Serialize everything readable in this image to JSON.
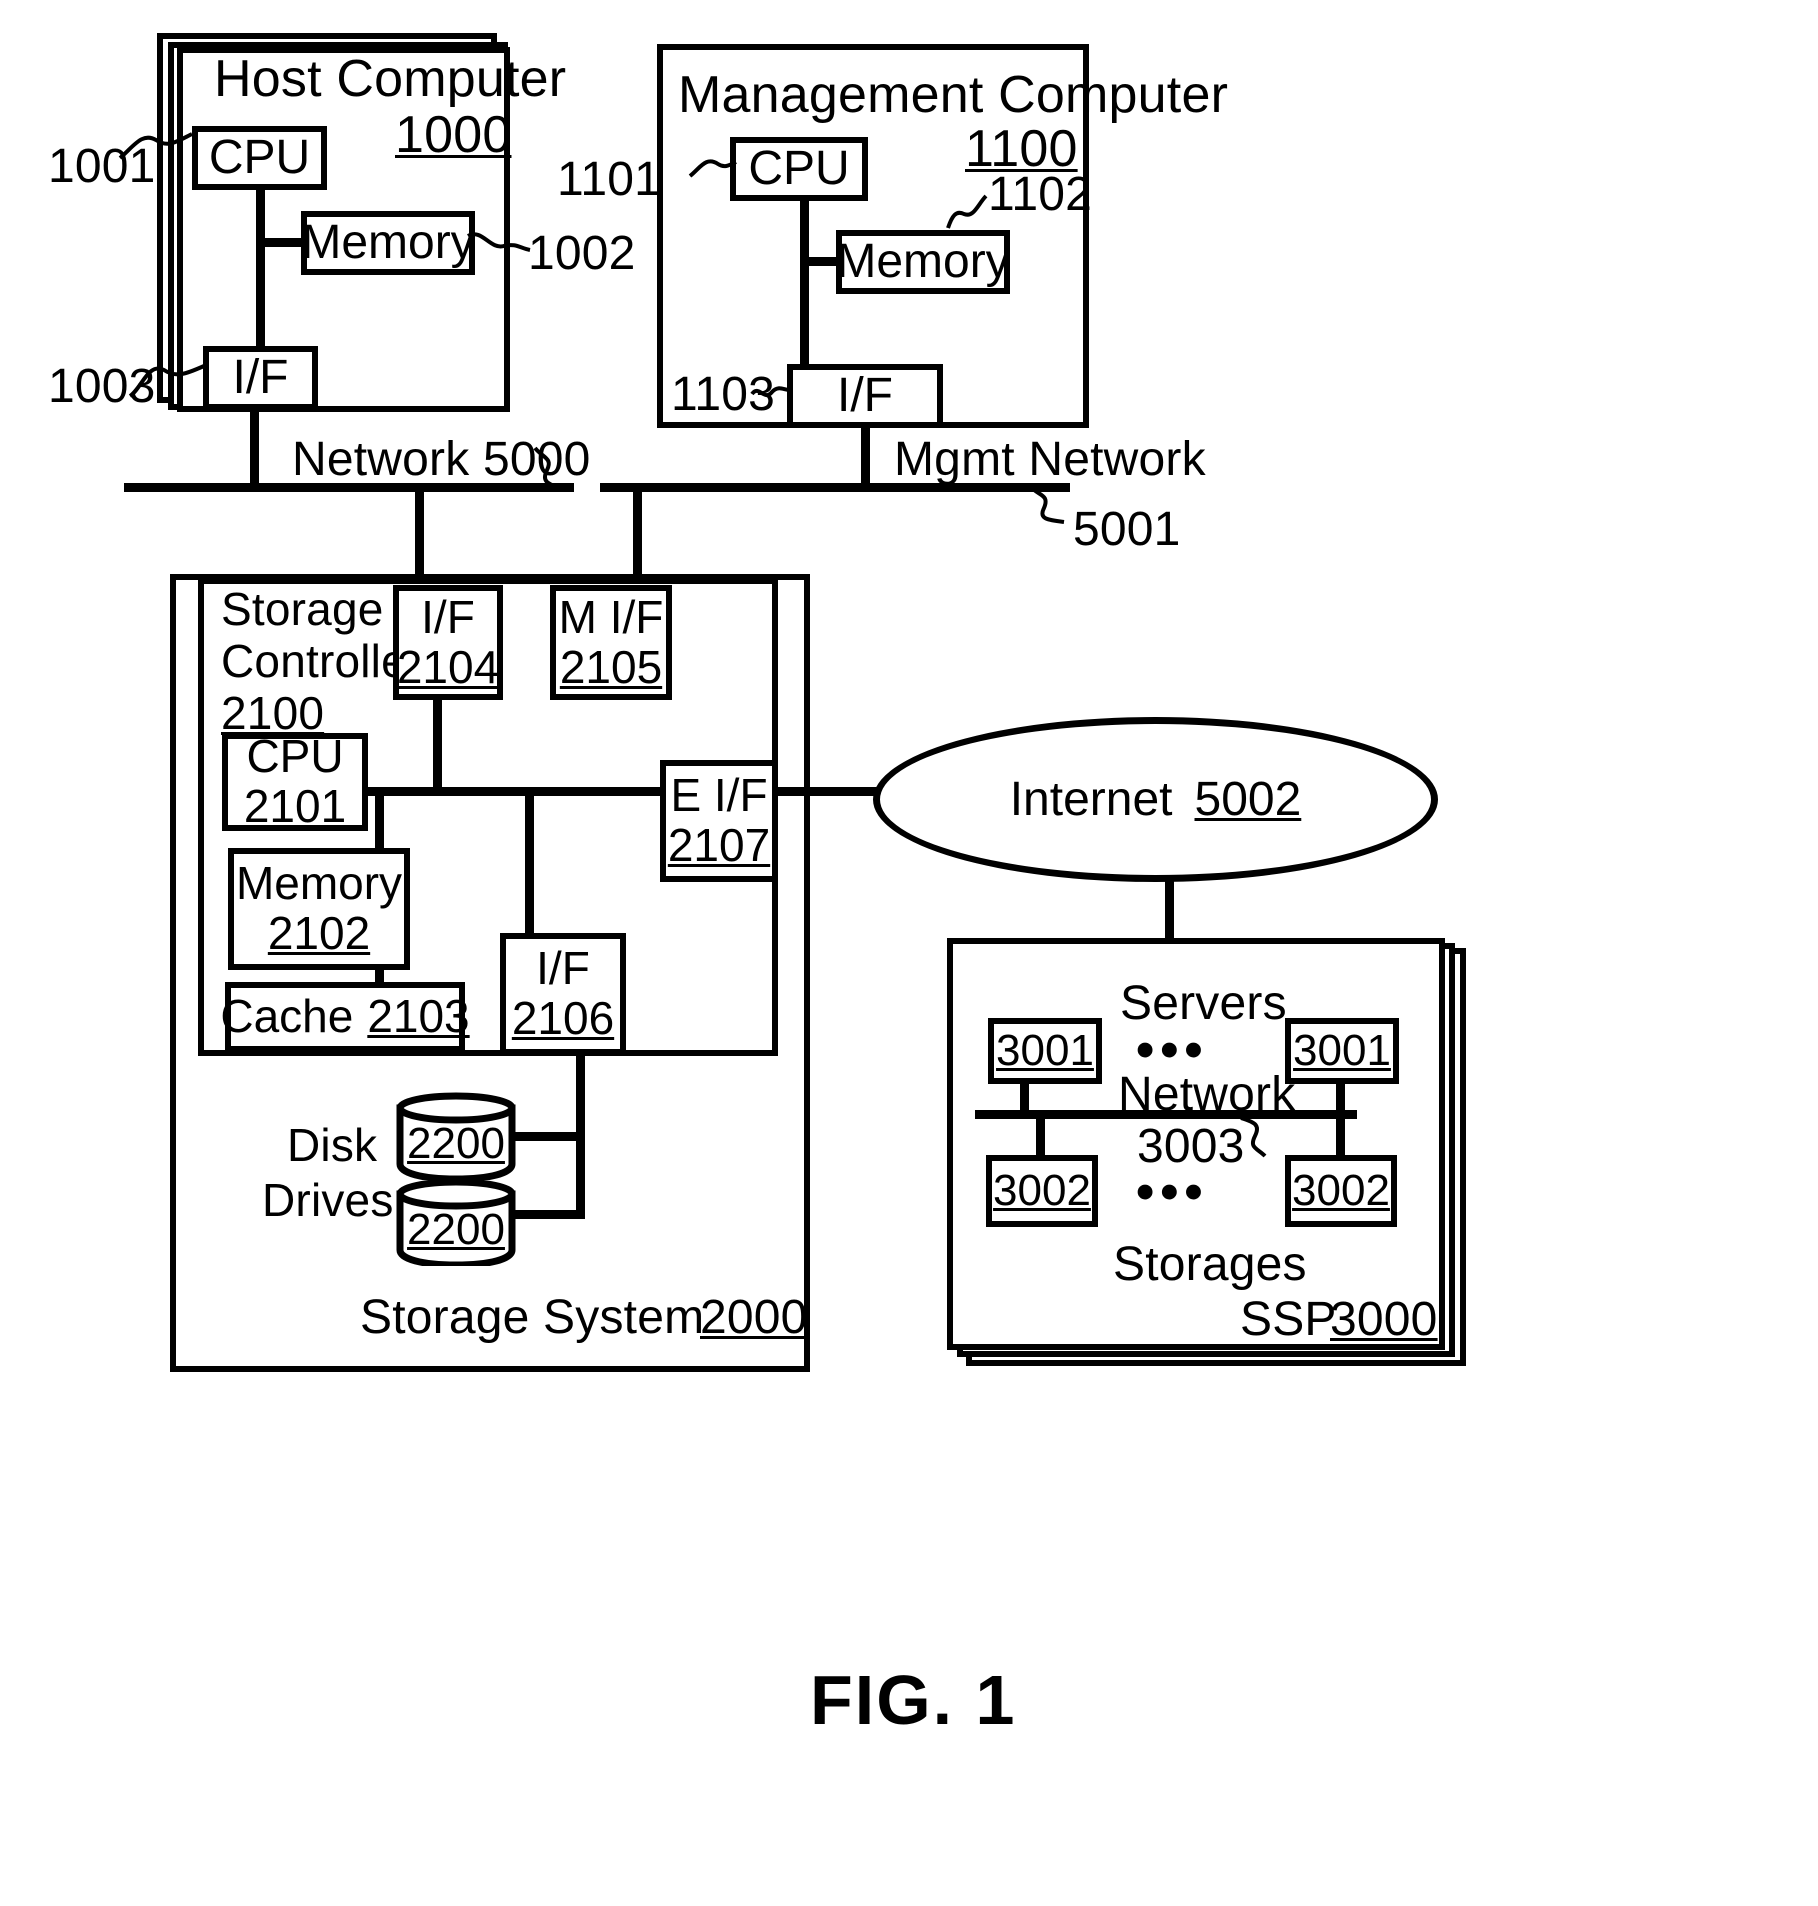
{
  "figure": {
    "caption": "FIG. 1"
  },
  "host_computer": {
    "title": "Host Computer",
    "ref": "1000",
    "cpu": {
      "label": "CPU",
      "ref": "1001"
    },
    "memory": {
      "label": "Memory",
      "ref": "1002"
    },
    "iface": {
      "label": "I/F",
      "ref": "1003"
    }
  },
  "management_computer": {
    "title": "Management Computer",
    "ref": "1100",
    "cpu": {
      "label": "CPU",
      "ref": "1101"
    },
    "memory": {
      "label": "Memory",
      "ref": "1102"
    },
    "iface": {
      "label": "I/F",
      "ref": "1103"
    }
  },
  "networks": {
    "data_network": {
      "label": "Network 5000"
    },
    "mgmt_network": {
      "label": "Mgmt Network",
      "ref": "5001"
    },
    "internet": {
      "label": "Internet",
      "ref": "5002"
    }
  },
  "storage_system": {
    "title": "Storage System",
    "ref": "2000",
    "controller": {
      "title_line1": "Storage",
      "title_line2": "Controller",
      "ref": "2100"
    },
    "cpu": {
      "label": "CPU",
      "ref": "2101"
    },
    "memory": {
      "label": "Memory",
      "ref": "2102"
    },
    "cache": {
      "label": "Cache",
      "ref": "2103"
    },
    "iface_host": {
      "label": "I/F",
      "ref": "2104"
    },
    "iface_mgmt": {
      "label": "M I/F",
      "ref": "2105"
    },
    "iface_disk": {
      "label": "I/F",
      "ref": "2106"
    },
    "iface_ext": {
      "label": "E I/F",
      "ref": "2107"
    },
    "disk_drives": {
      "label_line1": "Disk",
      "label_line2": "Drives",
      "drives": [
        {
          "ref": "2200"
        },
        {
          "ref": "2200"
        }
      ]
    }
  },
  "ssp": {
    "title": "SSP",
    "ref": "3000",
    "servers_label": "Servers",
    "storages_label": "Storages",
    "network_label": "Network",
    "network_ref": "3003",
    "servers": [
      {
        "ref": "3001"
      },
      {
        "ref": "3001"
      }
    ],
    "storages": [
      {
        "ref": "3002"
      },
      {
        "ref": "3002"
      }
    ],
    "ellipsis": "•••"
  },
  "colors": {
    "ink": "#000000",
    "paper": "#ffffff"
  }
}
